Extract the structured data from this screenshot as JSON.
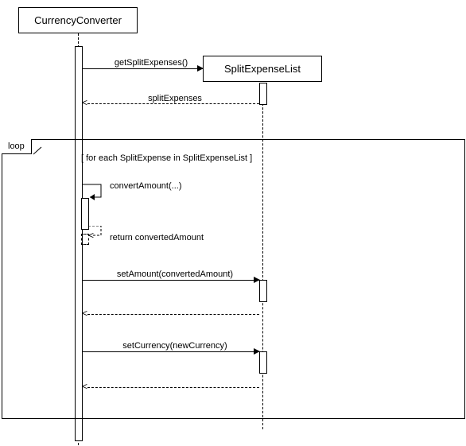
{
  "participants": {
    "currencyConverter": "CurrencyConverter",
    "splitExpenseList": "SplitExpenseList"
  },
  "messages": {
    "getSplitExpenses": "getSplitExpenses()",
    "splitExpensesReturn": "splitExpenses",
    "convertAmount": "convertAmount(...)",
    "returnConverted": "return convertedAmount",
    "setAmount": "setAmount(convertedAmount)",
    "setCurrency": "setCurrency(newCurrency)"
  },
  "fragment": {
    "operator": "loop",
    "guard": "[ for each SplitExpense in SplitExpenseList ]"
  },
  "chart_data": {
    "type": "sequence-diagram",
    "participants": [
      "CurrencyConverter",
      "SplitExpenseList"
    ],
    "interactions": [
      {
        "from": "CurrencyConverter",
        "to": "SplitExpenseList",
        "message": "getSplitExpenses()",
        "kind": "sync"
      },
      {
        "from": "SplitExpenseList",
        "to": "CurrencyConverter",
        "message": "splitExpenses",
        "kind": "return"
      },
      {
        "fragment": "loop",
        "guard": "for each SplitExpense in SplitExpenseList",
        "body": [
          {
            "from": "CurrencyConverter",
            "to": "CurrencyConverter",
            "message": "convertAmount(...)",
            "kind": "self-sync"
          },
          {
            "from": "CurrencyConverter",
            "to": "CurrencyConverter",
            "message": "return convertedAmount",
            "kind": "self-return"
          },
          {
            "from": "CurrencyConverter",
            "to": "SplitExpenseList",
            "message": "setAmount(convertedAmount)",
            "kind": "sync"
          },
          {
            "from": "SplitExpenseList",
            "to": "CurrencyConverter",
            "message": "",
            "kind": "return"
          },
          {
            "from": "CurrencyConverter",
            "to": "SplitExpenseList",
            "message": "setCurrency(newCurrency)",
            "kind": "sync"
          },
          {
            "from": "SplitExpenseList",
            "to": "CurrencyConverter",
            "message": "",
            "kind": "return"
          }
        ]
      }
    ]
  }
}
